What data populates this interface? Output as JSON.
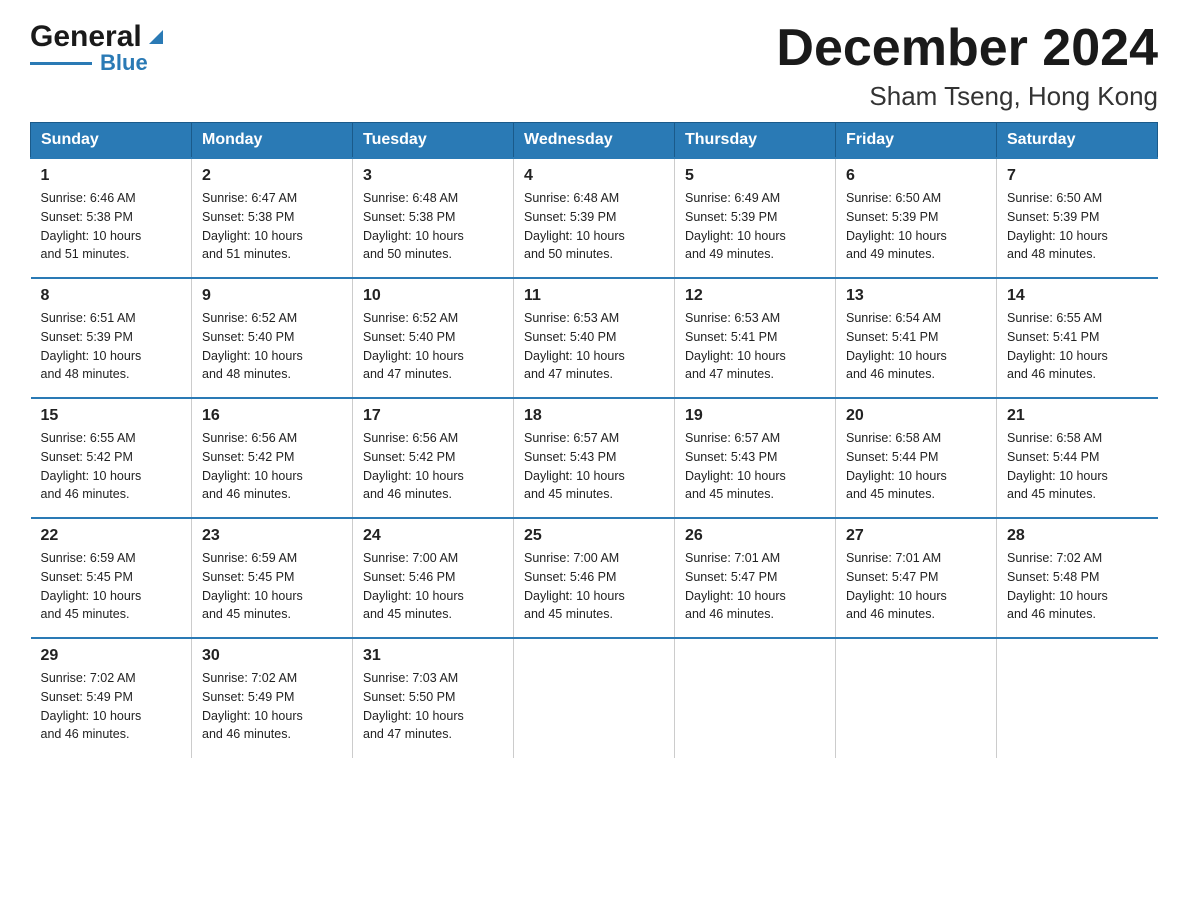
{
  "header": {
    "logo_general": "General",
    "logo_blue": "Blue",
    "month_title": "December 2024",
    "location": "Sham Tseng, Hong Kong"
  },
  "columns": [
    "Sunday",
    "Monday",
    "Tuesday",
    "Wednesday",
    "Thursday",
    "Friday",
    "Saturday"
  ],
  "weeks": [
    [
      {
        "day": "1",
        "sunrise": "6:46 AM",
        "sunset": "5:38 PM",
        "daylight": "10 hours and 51 minutes."
      },
      {
        "day": "2",
        "sunrise": "6:47 AM",
        "sunset": "5:38 PM",
        "daylight": "10 hours and 51 minutes."
      },
      {
        "day": "3",
        "sunrise": "6:48 AM",
        "sunset": "5:38 PM",
        "daylight": "10 hours and 50 minutes."
      },
      {
        "day": "4",
        "sunrise": "6:48 AM",
        "sunset": "5:39 PM",
        "daylight": "10 hours and 50 minutes."
      },
      {
        "day": "5",
        "sunrise": "6:49 AM",
        "sunset": "5:39 PM",
        "daylight": "10 hours and 49 minutes."
      },
      {
        "day": "6",
        "sunrise": "6:50 AM",
        "sunset": "5:39 PM",
        "daylight": "10 hours and 49 minutes."
      },
      {
        "day": "7",
        "sunrise": "6:50 AM",
        "sunset": "5:39 PM",
        "daylight": "10 hours and 48 minutes."
      }
    ],
    [
      {
        "day": "8",
        "sunrise": "6:51 AM",
        "sunset": "5:39 PM",
        "daylight": "10 hours and 48 minutes."
      },
      {
        "day": "9",
        "sunrise": "6:52 AM",
        "sunset": "5:40 PM",
        "daylight": "10 hours and 48 minutes."
      },
      {
        "day": "10",
        "sunrise": "6:52 AM",
        "sunset": "5:40 PM",
        "daylight": "10 hours and 47 minutes."
      },
      {
        "day": "11",
        "sunrise": "6:53 AM",
        "sunset": "5:40 PM",
        "daylight": "10 hours and 47 minutes."
      },
      {
        "day": "12",
        "sunrise": "6:53 AM",
        "sunset": "5:41 PM",
        "daylight": "10 hours and 47 minutes."
      },
      {
        "day": "13",
        "sunrise": "6:54 AM",
        "sunset": "5:41 PM",
        "daylight": "10 hours and 46 minutes."
      },
      {
        "day": "14",
        "sunrise": "6:55 AM",
        "sunset": "5:41 PM",
        "daylight": "10 hours and 46 minutes."
      }
    ],
    [
      {
        "day": "15",
        "sunrise": "6:55 AM",
        "sunset": "5:42 PM",
        "daylight": "10 hours and 46 minutes."
      },
      {
        "day": "16",
        "sunrise": "6:56 AM",
        "sunset": "5:42 PM",
        "daylight": "10 hours and 46 minutes."
      },
      {
        "day": "17",
        "sunrise": "6:56 AM",
        "sunset": "5:42 PM",
        "daylight": "10 hours and 46 minutes."
      },
      {
        "day": "18",
        "sunrise": "6:57 AM",
        "sunset": "5:43 PM",
        "daylight": "10 hours and 45 minutes."
      },
      {
        "day": "19",
        "sunrise": "6:57 AM",
        "sunset": "5:43 PM",
        "daylight": "10 hours and 45 minutes."
      },
      {
        "day": "20",
        "sunrise": "6:58 AM",
        "sunset": "5:44 PM",
        "daylight": "10 hours and 45 minutes."
      },
      {
        "day": "21",
        "sunrise": "6:58 AM",
        "sunset": "5:44 PM",
        "daylight": "10 hours and 45 minutes."
      }
    ],
    [
      {
        "day": "22",
        "sunrise": "6:59 AM",
        "sunset": "5:45 PM",
        "daylight": "10 hours and 45 minutes."
      },
      {
        "day": "23",
        "sunrise": "6:59 AM",
        "sunset": "5:45 PM",
        "daylight": "10 hours and 45 minutes."
      },
      {
        "day": "24",
        "sunrise": "7:00 AM",
        "sunset": "5:46 PM",
        "daylight": "10 hours and 45 minutes."
      },
      {
        "day": "25",
        "sunrise": "7:00 AM",
        "sunset": "5:46 PM",
        "daylight": "10 hours and 45 minutes."
      },
      {
        "day": "26",
        "sunrise": "7:01 AM",
        "sunset": "5:47 PM",
        "daylight": "10 hours and 46 minutes."
      },
      {
        "day": "27",
        "sunrise": "7:01 AM",
        "sunset": "5:47 PM",
        "daylight": "10 hours and 46 minutes."
      },
      {
        "day": "28",
        "sunrise": "7:02 AM",
        "sunset": "5:48 PM",
        "daylight": "10 hours and 46 minutes."
      }
    ],
    [
      {
        "day": "29",
        "sunrise": "7:02 AM",
        "sunset": "5:49 PM",
        "daylight": "10 hours and 46 minutes."
      },
      {
        "day": "30",
        "sunrise": "7:02 AM",
        "sunset": "5:49 PM",
        "daylight": "10 hours and 46 minutes."
      },
      {
        "day": "31",
        "sunrise": "7:03 AM",
        "sunset": "5:50 PM",
        "daylight": "10 hours and 47 minutes."
      },
      null,
      null,
      null,
      null
    ]
  ],
  "labels": {
    "sunrise": "Sunrise:",
    "sunset": "Sunset:",
    "daylight": "Daylight:"
  }
}
